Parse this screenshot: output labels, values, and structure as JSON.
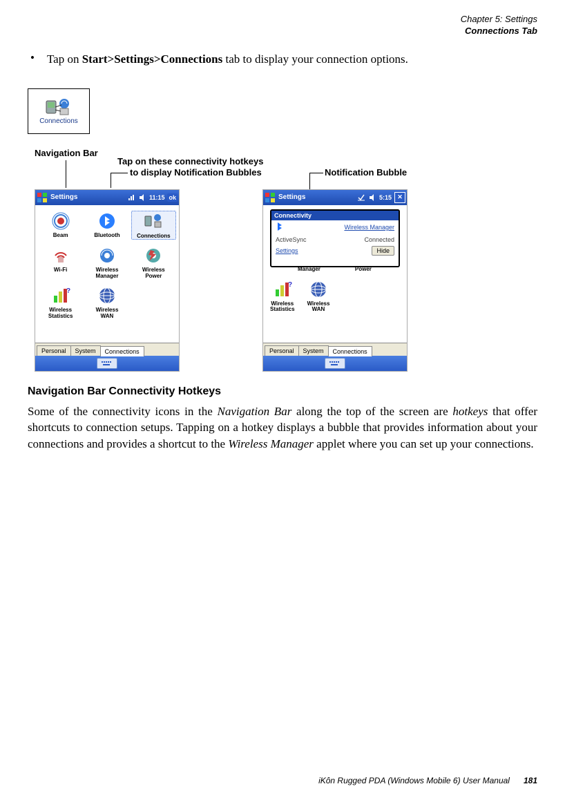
{
  "header": {
    "chapter_line": "Chapter 5: Settings",
    "section_line": "Connections Tab"
  },
  "bullet": {
    "prefix": "Tap on ",
    "bold_path": "Start>Settings>Connections",
    "suffix": " tab to display your connection options."
  },
  "connections_icon_label": "Connections",
  "callouts": {
    "nav_bar": "Navigation Bar",
    "hotkeys_line1": "Tap on these connectivity hotkeys",
    "hotkeys_line2": "to display Notification Bubbles",
    "notification_bubble": "Notification Bubble"
  },
  "screen1": {
    "title": "Settings",
    "time": "11:15",
    "ok": "ok",
    "apps": [
      {
        "label": "Beam"
      },
      {
        "label": "Bluetooth"
      },
      {
        "label": "Connections"
      },
      {
        "label": "Wi-Fi"
      },
      {
        "label": "Wireless\nManager"
      },
      {
        "label": "Wireless\nPower"
      },
      {
        "label": "Wireless\nStatistics"
      },
      {
        "label": "Wireless\nWAN"
      }
    ],
    "tabs": [
      "Personal",
      "System",
      "Connections"
    ]
  },
  "screen2": {
    "title": "Settings",
    "time": "5:15",
    "bubble": {
      "title": "Connectivity",
      "wm_link": "Wireless Manager",
      "row2_label": "ActiveSync",
      "row2_value": "Connected",
      "settings_link": "Settings",
      "hide_btn": "Hide"
    },
    "visible_labels": {
      "manager": "Manager",
      "power": "Power",
      "stats": "Wireless\nStatistics",
      "wwan": "Wireless\nWAN"
    },
    "tabs": [
      "Personal",
      "System",
      "Connections"
    ]
  },
  "heading": "Navigation Bar Connectivity Hotkeys",
  "paragraph": {
    "p1": "Some of the connectivity icons in the ",
    "i1": "Navigation Bar",
    "p2": " along the top of the screen are ",
    "i2": "hotkeys",
    "p3": " that offer shortcuts to connection setups. Tapping on a hotkey displays a bubble that provides information about your connections and provides a shortcut to the ",
    "i3": "Wireless Manager",
    "p4": " applet where you can set up your connections."
  },
  "footer": {
    "manual": "iKôn Rugged PDA (Windows Mobile 6) User Manual",
    "page": "181"
  }
}
